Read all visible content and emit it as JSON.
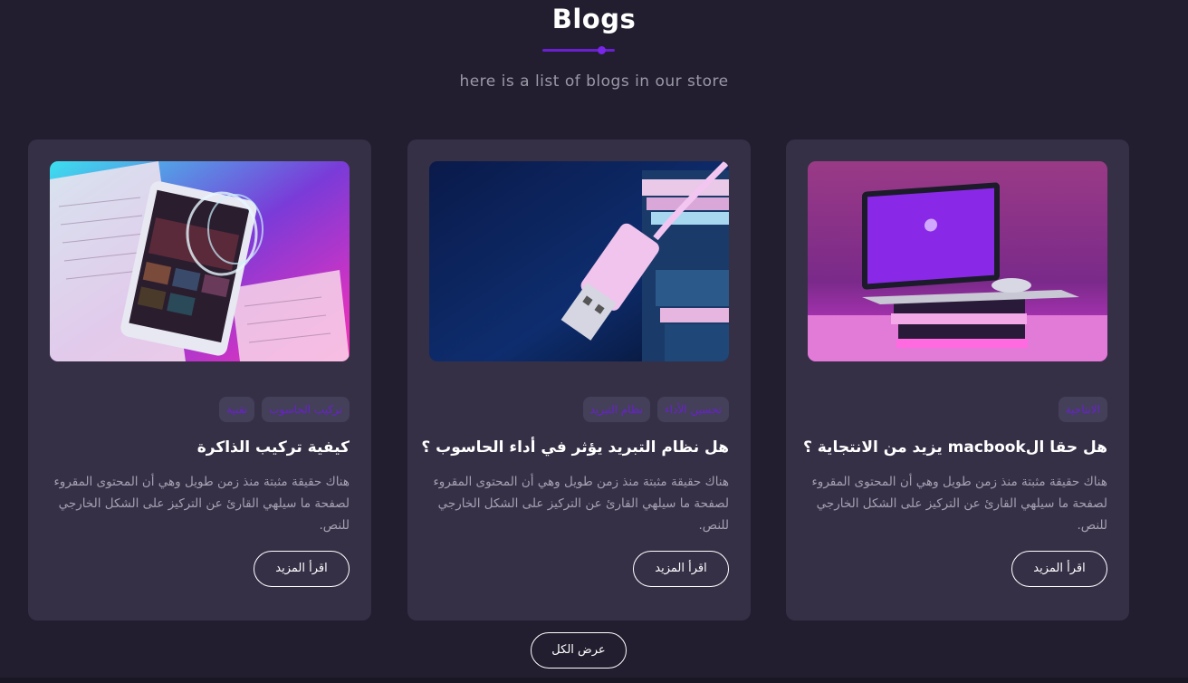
{
  "header": {
    "title": "Blogs",
    "subtitle": "here is a list of blogs in our store"
  },
  "colors": {
    "background": "#221e2f",
    "card": "#363047",
    "accent": "#6a1fd1",
    "tag_bg": "#44405a",
    "muted_text": "#a4a1b0"
  },
  "cards": [
    {
      "image_icon": "tablet-books-image",
      "tags": [
        "تركيب الحاسوب",
        "تقنية"
      ],
      "title": "كيفية تركيب الذاكرة",
      "description": "هناك حقيقة مثبتة منذ زمن طويل وهي أن المحتوى المقروء لصفحة ما سيلهي القارئ عن التركيز على الشكل الخارجي للنص.",
      "button": "اقرأ المزيد"
    },
    {
      "image_icon": "usb-cable-image",
      "tags": [
        "تحسين الأداء",
        "نظام التبريد"
      ],
      "title": "هل نظام التبريد يؤثر في أداء الحاسوب ؟",
      "description": "هناك حقيقة مثبتة منذ زمن طويل وهي أن المحتوى المقروء لصفحة ما سيلهي القارئ عن التركيز على الشكل الخارجي للنص.",
      "button": "اقرأ المزيد"
    },
    {
      "image_icon": "laptop-books-image",
      "tags": [
        "الانتاجية"
      ],
      "title": "هل حقا الmacbook يزيد من الانتجاية ؟",
      "description": "هناك حقيقة مثبتة منذ زمن طويل وهي أن المحتوى المقروء لصفحة ما سيلهي القارئ عن التركيز على الشكل الخارجي للنص.",
      "button": "اقرأ المزيد"
    }
  ],
  "footer": {
    "view_all": "عرض الكل"
  }
}
